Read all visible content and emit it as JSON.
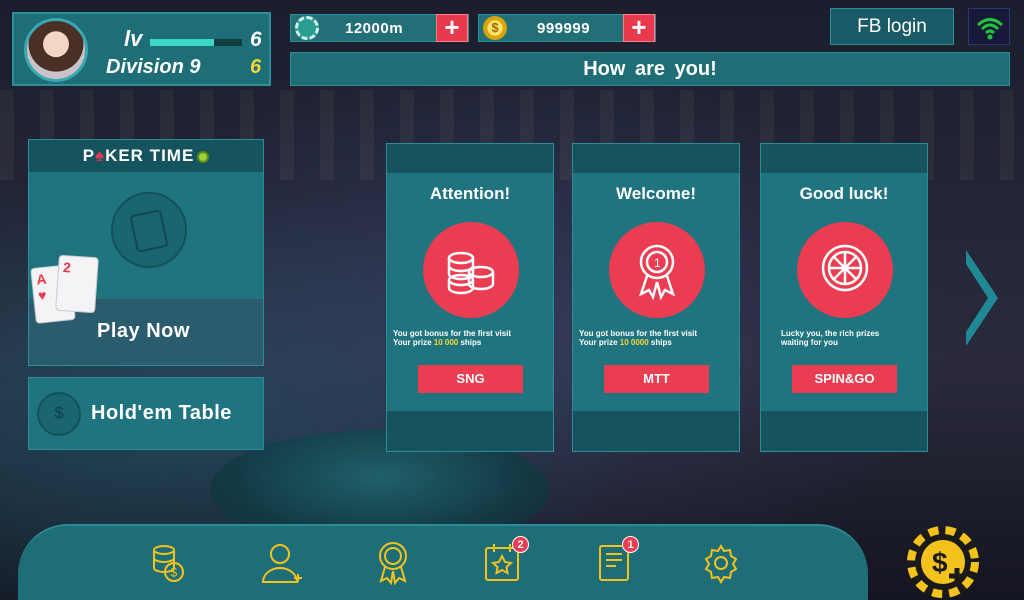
{
  "profile": {
    "name": "lv",
    "level": "6",
    "xp_progress": 0.7,
    "division_label": "Division 9",
    "division_value": "6"
  },
  "currency": {
    "chips": "12000m",
    "coins": "999999",
    "add_symbol": "+"
  },
  "header": {
    "fb_login": "FB login",
    "message": "How  are you!"
  },
  "poker_time": {
    "title_left": "P",
    "title_spade": "♠",
    "title_right": "KER TIME",
    "play_now": "Play Now",
    "card_rank_1": "A",
    "card_rank_2": "2"
  },
  "holdem": {
    "label": "Hold'em Table",
    "icon_symbol": "$"
  },
  "bonus_cards": [
    {
      "title": "Attention!",
      "desc_line1": "You got bonus for the first visit",
      "desc_prefix": "Your prize ",
      "desc_highlight": "10 000",
      "desc_suffix": " ships",
      "button": "SNG"
    },
    {
      "title": "Welcome!",
      "desc_line1": "You got bonus for the first visit",
      "desc_prefix": "Your prize ",
      "desc_highlight": "10 0000",
      "desc_suffix": " ships",
      "button": "MTT"
    },
    {
      "title": "Good luck!",
      "desc_line1": "Lucky you, the rich prizes",
      "desc_prefix": "waiting for you",
      "desc_highlight": "",
      "desc_suffix": "",
      "button": "SPIN&GO"
    }
  ],
  "nav": {
    "badges": {
      "missions": "2",
      "mail": "1"
    },
    "icons": [
      "money-bag-icon",
      "add-friend-icon",
      "medal-icon",
      "missions-icon",
      "mail-icon",
      "settings-icon"
    ],
    "shop_icon": "buy-chips-icon"
  },
  "colors": {
    "accent_red": "#ea3d51",
    "panel_teal": "#1f7480",
    "highlight_yellow": "#f3d63a",
    "icon_gold": "#f3c21c"
  }
}
